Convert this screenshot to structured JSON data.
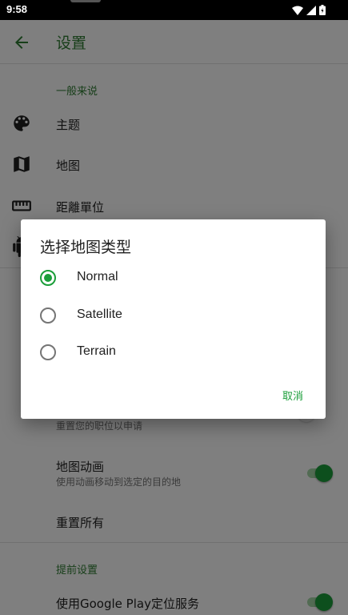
{
  "status_bar": {
    "time": "9:58"
  },
  "app_bar": {
    "title": "设置"
  },
  "sections": {
    "general": {
      "header": "一般来说",
      "items": [
        {
          "icon": "palette-icon",
          "title": "主题"
        },
        {
          "icon": "map-icon",
          "title": "地图"
        },
        {
          "icon": "ruler-icon",
          "title": "距離單位"
        },
        {
          "icon": "android-icon",
          "title": ""
        }
      ]
    },
    "more": {
      "reset_position_sub": "重置您的职位以申请",
      "map_animation": {
        "title": "地图动画",
        "sub": "使用动画移动到选定的目的地",
        "enabled": true
      },
      "reset_all": "重置所有"
    },
    "advanced": {
      "header": "提前设置",
      "google_play": {
        "title": "使用Google Play定位服务",
        "enabled": true
      }
    }
  },
  "dialog": {
    "title": "选择地图类型",
    "options": [
      {
        "label": "Normal",
        "selected": true
      },
      {
        "label": "Satellite",
        "selected": false
      },
      {
        "label": "Terrain",
        "selected": false
      }
    ],
    "cancel": "取消"
  },
  "colors": {
    "accent": "#1b9e3a",
    "title": "#2e7d32"
  }
}
